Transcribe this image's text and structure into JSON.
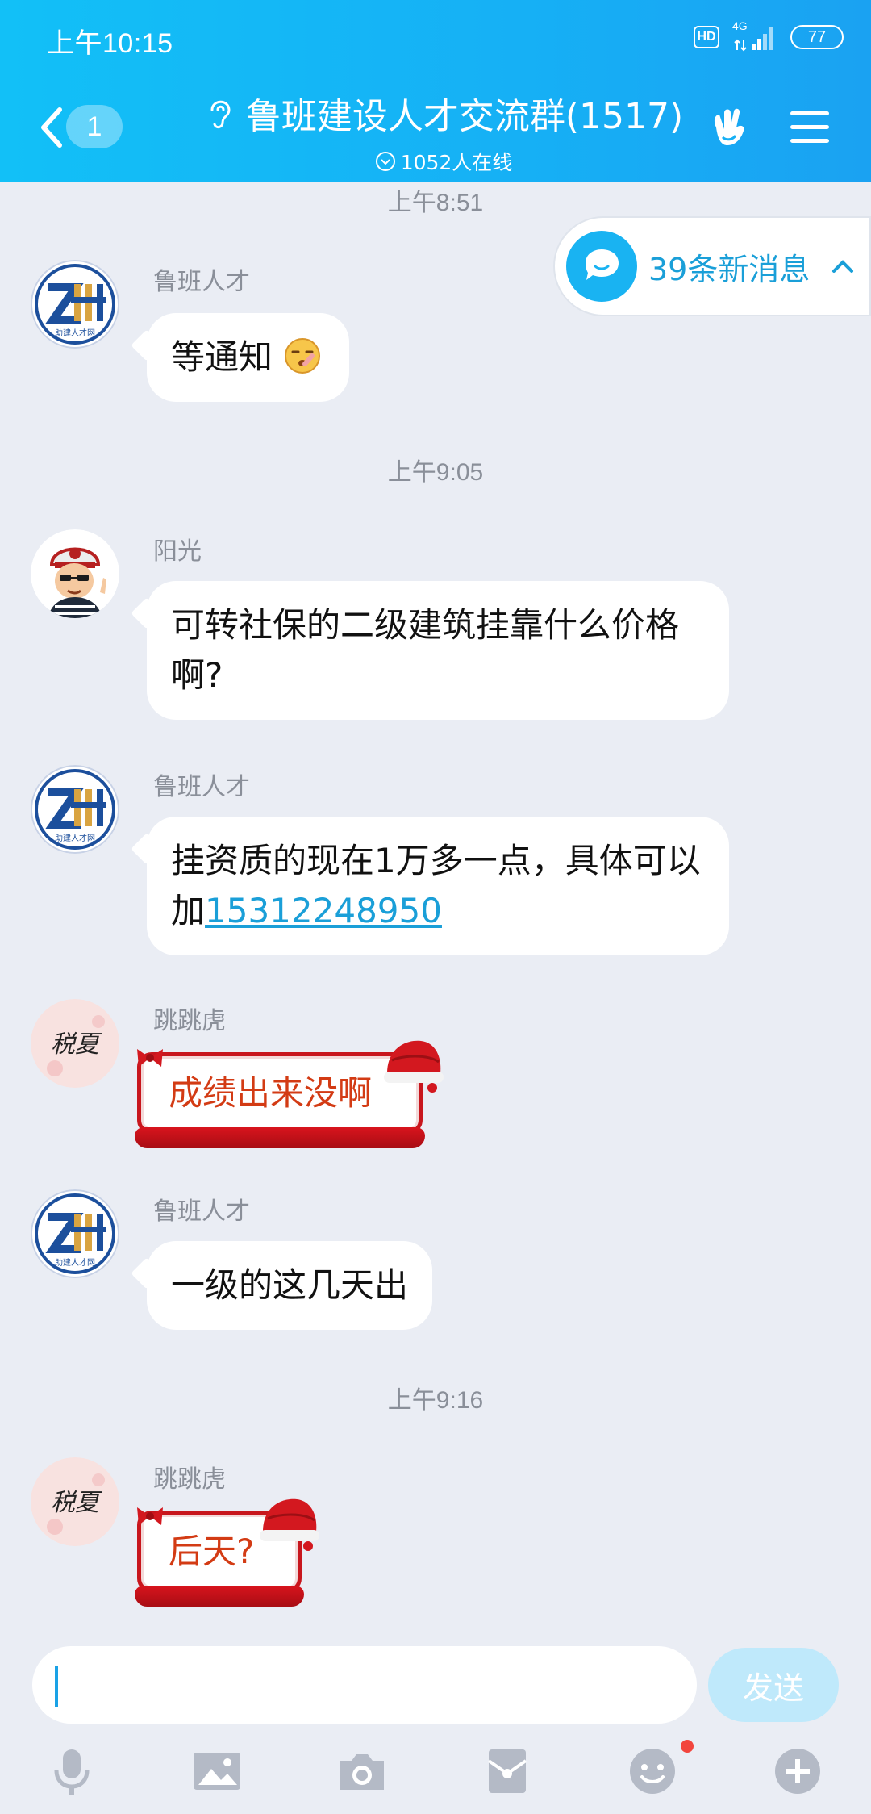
{
  "status_bar": {
    "time": "上午10:15",
    "hd": "HD",
    "network": "4G",
    "battery": "77"
  },
  "header": {
    "unread_count": "1",
    "title": "鲁班建设人才交流群(1517)",
    "online": "1052人在线"
  },
  "new_messages": {
    "label": "39条新消息"
  },
  "messages": [
    {
      "time": "上午8:51"
    },
    {
      "sender": "鲁班人才",
      "text": "等通知",
      "avatar_text": "助建人才网"
    },
    {
      "time": "上午9:05"
    },
    {
      "sender": "阳光",
      "text": "可转社保的二级建筑挂靠什么价格啊?"
    },
    {
      "sender": "鲁班人才",
      "text_prefix": "挂资质的现在1万多一点，具体可以加",
      "phone": "15312248950",
      "avatar_text": "助建人才网"
    },
    {
      "sender": "跳跳虎",
      "text": "成绩出来没啊",
      "avatar_text": "税夏"
    },
    {
      "sender": "鲁班人才",
      "text": "一级的这几天出",
      "avatar_text": "助建人才网"
    },
    {
      "time": "上午9:16"
    },
    {
      "sender": "跳跳虎",
      "text": "后天?",
      "avatar_text": "税夏"
    }
  ],
  "composer": {
    "send_label": "发送"
  },
  "toolbar": {
    "icons": [
      "microphone-icon",
      "image-icon",
      "camera-icon",
      "red-packet-icon",
      "emoji-icon",
      "plus-icon"
    ]
  },
  "colors": {
    "header": "#16b0f5",
    "link": "#1a9fd8",
    "festive_red": "#c8161d",
    "festive_text": "#d33b14"
  }
}
